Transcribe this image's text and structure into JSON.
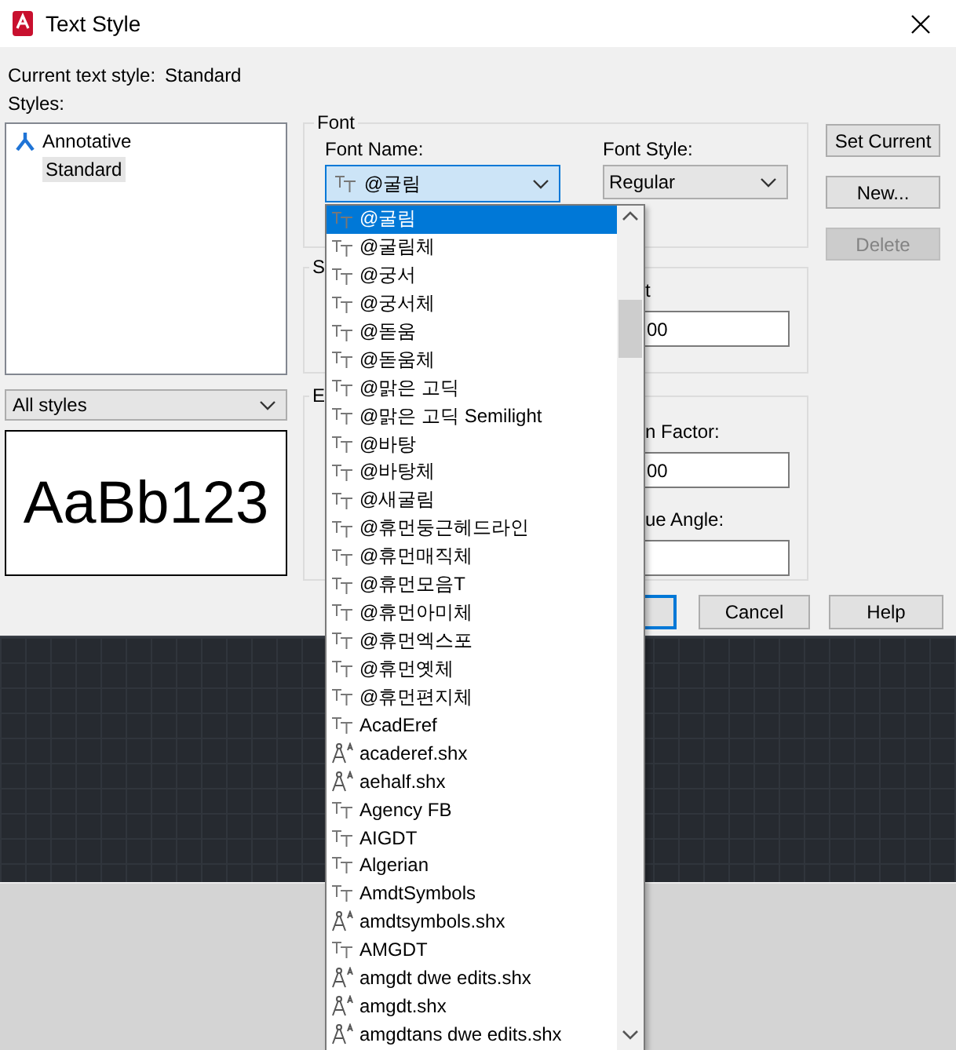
{
  "window": {
    "title": "Text Style"
  },
  "current_style": {
    "label": "Current text style:",
    "value": "Standard"
  },
  "styles": {
    "label": "Styles:",
    "items": [
      {
        "name": "Annotative",
        "annotative": true,
        "selected": false
      },
      {
        "name": "Standard",
        "annotative": false,
        "selected": true
      }
    ],
    "filter": "All styles",
    "preview": "AaBb123"
  },
  "font": {
    "group_label": "Font",
    "font_name_label": "Font Name:",
    "font_name_value": "@굴림",
    "font_style_label": "Font Style:",
    "font_style_value": "Regular"
  },
  "size": {
    "group_label": "S",
    "height_label": "t",
    "height_value": "00"
  },
  "effects": {
    "group_label": "E",
    "width_factor_label": "n Factor:",
    "width_factor_value": "00",
    "oblique_angle_label": "ue Angle:"
  },
  "side_buttons": [
    {
      "label": "Set Current",
      "disabled": false
    },
    {
      "label": "New...",
      "disabled": false
    },
    {
      "label": "Delete",
      "disabled": true
    }
  ],
  "bottom_buttons": [
    {
      "focused": true
    },
    {
      "label": "Cancel",
      "focused": false
    },
    {
      "label": "Help",
      "focused": false
    }
  ],
  "font_dropdown": {
    "items": [
      {
        "name": "@굴림",
        "kind": "truetype",
        "selected": true
      },
      {
        "name": "@굴림체",
        "kind": "truetype",
        "selected": false
      },
      {
        "name": "@궁서",
        "kind": "truetype",
        "selected": false
      },
      {
        "name": "@궁서체",
        "kind": "truetype",
        "selected": false
      },
      {
        "name": "@돋움",
        "kind": "truetype",
        "selected": false
      },
      {
        "name": "@돋움체",
        "kind": "truetype",
        "selected": false
      },
      {
        "name": "@맑은 고딕",
        "kind": "truetype",
        "selected": false
      },
      {
        "name": "@맑은 고딕 Semilight",
        "kind": "truetype",
        "selected": false
      },
      {
        "name": "@바탕",
        "kind": "truetype",
        "selected": false
      },
      {
        "name": "@바탕체",
        "kind": "truetype",
        "selected": false
      },
      {
        "name": "@새굴림",
        "kind": "truetype",
        "selected": false
      },
      {
        "name": "@휴먼둥근헤드라인",
        "kind": "truetype",
        "selected": false
      },
      {
        "name": "@휴먼매직체",
        "kind": "truetype",
        "selected": false
      },
      {
        "name": "@휴먼모음T",
        "kind": "truetype",
        "selected": false
      },
      {
        "name": "@휴먼아미체",
        "kind": "truetype",
        "selected": false
      },
      {
        "name": "@휴먼엑스포",
        "kind": "truetype",
        "selected": false
      },
      {
        "name": "@휴먼옛체",
        "kind": "truetype",
        "selected": false
      },
      {
        "name": "@휴먼편지체",
        "kind": "truetype",
        "selected": false
      },
      {
        "name": "AcadEref",
        "kind": "truetype",
        "selected": false
      },
      {
        "name": "acaderef.shx",
        "kind": "shx",
        "selected": false
      },
      {
        "name": "aehalf.shx",
        "kind": "shx",
        "selected": false
      },
      {
        "name": "Agency FB",
        "kind": "truetype",
        "selected": false
      },
      {
        "name": "AIGDT",
        "kind": "truetype",
        "selected": false
      },
      {
        "name": "Algerian",
        "kind": "truetype",
        "selected": false
      },
      {
        "name": "AmdtSymbols",
        "kind": "truetype",
        "selected": false
      },
      {
        "name": "amdtsymbols.shx",
        "kind": "shx",
        "selected": false
      },
      {
        "name": "AMGDT",
        "kind": "truetype",
        "selected": false
      },
      {
        "name": "amgdt dwe edits.shx",
        "kind": "shx",
        "selected": false
      },
      {
        "name": "amgdt.shx",
        "kind": "shx",
        "selected": false
      },
      {
        "name": "amgdtans dwe edits.shx",
        "kind": "shx",
        "selected": false
      }
    ]
  }
}
